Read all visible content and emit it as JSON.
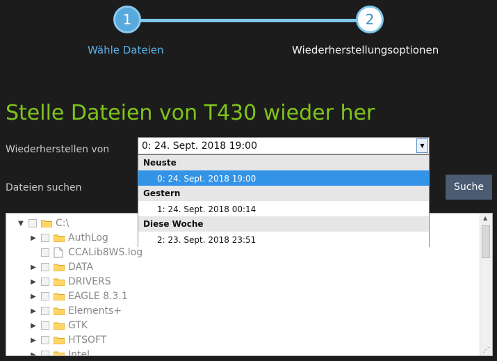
{
  "stepper": {
    "step1": {
      "number": "1",
      "label": "Wähle Dateien"
    },
    "step2": {
      "number": "2",
      "label": "Wiederherstellungsoptionen"
    }
  },
  "page_title": "Stelle Dateien von T430 wieder her",
  "restore_from": {
    "label": "Wiederherstellen von",
    "selected": "0: 24. Sept. 2018 19:00"
  },
  "dropdown": {
    "groups": [
      {
        "name": "Neuste",
        "items": [
          "0: 24. Sept. 2018 19:00"
        ]
      },
      {
        "name": "Gestern",
        "items": [
          "1: 24. Sept. 2018 00:14"
        ]
      },
      {
        "name": "Diese Woche",
        "items": [
          "2: 23. Sept. 2018 23:51"
        ]
      }
    ]
  },
  "search": {
    "label": "Dateien suchen",
    "button": "Suche"
  },
  "tree": {
    "root": "C:\\",
    "items": [
      {
        "name": "AuthLog",
        "type": "folder"
      },
      {
        "name": "CCALib8WS.log",
        "type": "file"
      },
      {
        "name": "DATA",
        "type": "folder"
      },
      {
        "name": "DRIVERS",
        "type": "folder"
      },
      {
        "name": "EAGLE 8.3.1",
        "type": "folder"
      },
      {
        "name": "Elements+",
        "type": "folder"
      },
      {
        "name": "GTK",
        "type": "folder"
      },
      {
        "name": "HTSOFT",
        "type": "folder"
      },
      {
        "name": "Intel",
        "type": "folder"
      }
    ]
  },
  "colors": {
    "accent_green": "#7fc41a",
    "step_blue": "#58a9dc",
    "selection_blue": "#3393e6",
    "button_slate": "#4a5b72"
  }
}
